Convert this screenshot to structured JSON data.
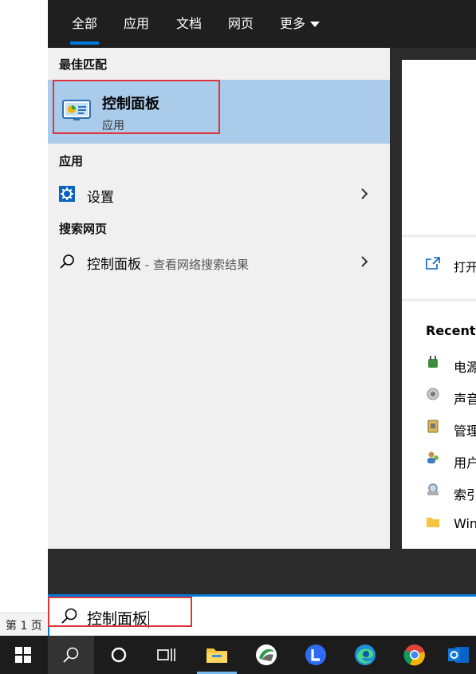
{
  "document": {
    "status_page": "第 1 页"
  },
  "tabs": [
    {
      "label": "全部"
    },
    {
      "label": "应用"
    },
    {
      "label": "文档"
    },
    {
      "label": "网页"
    },
    {
      "label": "更多"
    }
  ],
  "best_match": {
    "section_title": "最佳匹配",
    "title": "控制面板",
    "subtitle": "应用"
  },
  "apps": {
    "section_title": "应用",
    "items": [
      {
        "label": "设置",
        "icon": "gear-icon"
      }
    ]
  },
  "web": {
    "section_title": "搜索网页",
    "query": "控制面板",
    "suffix": " - 查看网络搜索结果"
  },
  "preview": {
    "open_label": "打开",
    "recent_title": "Recent",
    "recent_items": [
      "电源",
      "声音",
      "管理",
      "用户",
      "索引",
      "Win"
    ]
  },
  "search": {
    "value": "控制面板"
  },
  "taskbar": {
    "items": [
      "start-icon",
      "search-icon",
      "cortana-icon",
      "task-view-icon",
      "file-explorer-icon",
      "app-icon",
      "lark-icon",
      "edge-icon",
      "chrome-icon",
      "outlook-icon"
    ]
  },
  "colors": {
    "accent": "#0078d7",
    "highlight": "#e0343d",
    "selection": "#aacbea"
  }
}
